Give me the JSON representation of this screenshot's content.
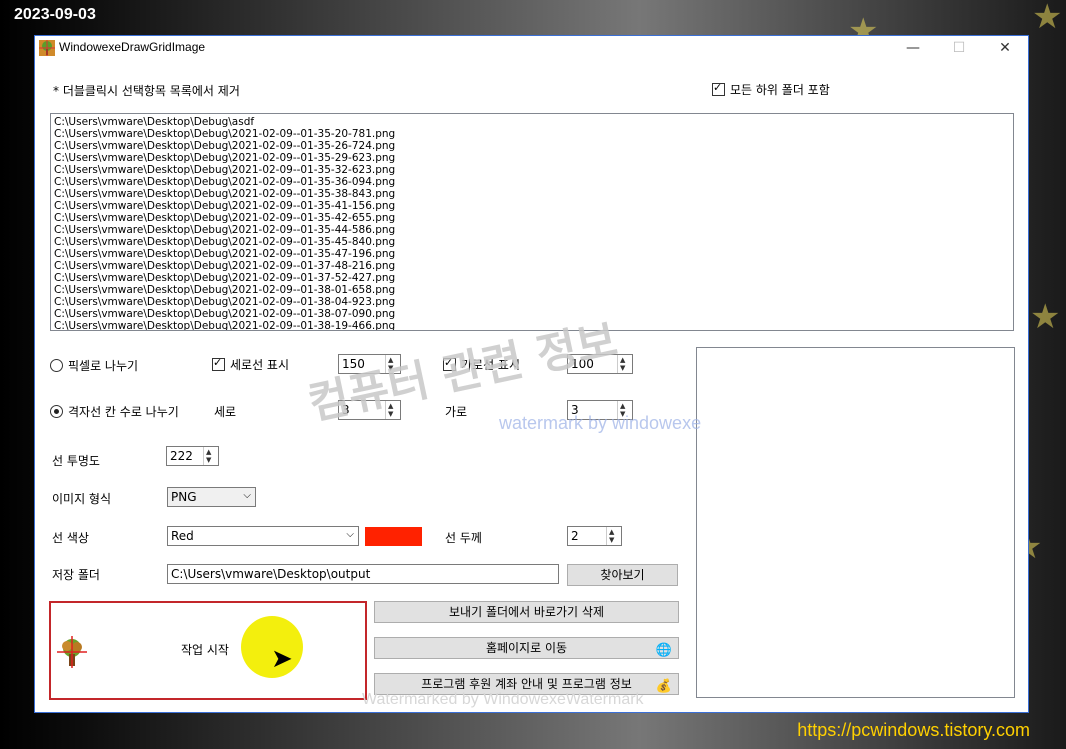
{
  "overlay": {
    "date": "2023-09-03",
    "site_url": "https://pcwindows.tistory.com"
  },
  "window": {
    "title": "WindowexeDrawGridImage",
    "minimize": "—",
    "maximize": "☐",
    "close": "✕"
  },
  "header": {
    "hint": "* 더블클릭시 선택항목 목록에서 제거",
    "include_subfolders": "모든 하위 폴더 포함"
  },
  "files": [
    "C:\\Users\\vmware\\Desktop\\Debug\\asdf",
    "C:\\Users\\vmware\\Desktop\\Debug\\2021-02-09--01-35-20-781.png",
    "C:\\Users\\vmware\\Desktop\\Debug\\2021-02-09--01-35-26-724.png",
    "C:\\Users\\vmware\\Desktop\\Debug\\2021-02-09--01-35-29-623.png",
    "C:\\Users\\vmware\\Desktop\\Debug\\2021-02-09--01-35-32-623.png",
    "C:\\Users\\vmware\\Desktop\\Debug\\2021-02-09--01-35-36-094.png",
    "C:\\Users\\vmware\\Desktop\\Debug\\2021-02-09--01-35-38-843.png",
    "C:\\Users\\vmware\\Desktop\\Debug\\2021-02-09--01-35-41-156.png",
    "C:\\Users\\vmware\\Desktop\\Debug\\2021-02-09--01-35-42-655.png",
    "C:\\Users\\vmware\\Desktop\\Debug\\2021-02-09--01-35-44-586.png",
    "C:\\Users\\vmware\\Desktop\\Debug\\2021-02-09--01-35-45-840.png",
    "C:\\Users\\vmware\\Desktop\\Debug\\2021-02-09--01-35-47-196.png",
    "C:\\Users\\vmware\\Desktop\\Debug\\2021-02-09--01-37-48-216.png",
    "C:\\Users\\vmware\\Desktop\\Debug\\2021-02-09--01-37-52-427.png",
    "C:\\Users\\vmware\\Desktop\\Debug\\2021-02-09--01-38-01-658.png",
    "C:\\Users\\vmware\\Desktop\\Debug\\2021-02-09--01-38-04-923.png",
    "C:\\Users\\vmware\\Desktop\\Debug\\2021-02-09--01-38-07-090.png",
    "C:\\Users\\vmware\\Desktop\\Debug\\2021-02-09--01-38-19-466.png"
  ],
  "grid": {
    "pixel_mode_label": "픽셀로 나누기",
    "vertical_line_label": "세로선 표시",
    "vertical_line_value": "150",
    "horizontal_line_label": "가로선 표시",
    "horizontal_line_value": "100",
    "cell_mode_label": "격자선 칸 수로 나누기",
    "rows_label": "세로",
    "rows_value": "3",
    "cols_label": "가로",
    "cols_value": "3",
    "opacity_label": "선 투명도",
    "opacity_value": "222",
    "format_label": "이미지 형식",
    "format_value": "PNG",
    "color_label": "선 색상",
    "color_value": "Red",
    "color_hex": "#ff2200",
    "thickness_label": "선 두께",
    "thickness_value": "2",
    "folder_label": "저장 폴더",
    "folder_value": "C:\\Users\\vmware\\Desktop\\output",
    "browse_button": "찾아보기"
  },
  "actions": {
    "start_button": "작업 시작",
    "delete_shortcut_button": "보내기 폴더에서 바로가기 삭제",
    "homepage_button": "홈페이지로 이동",
    "donate_button": "프로그램 후원 계좌 안내 및 프로그램 정보"
  },
  "icons": {
    "globe": "globe-icon",
    "coins": "coins-icon",
    "tree": "tree-icon",
    "cursor": "mouse-cursor-icon"
  },
  "watermarks": {
    "korean": "컴퓨터 관련 정보",
    "english": "watermark by windowexe",
    "bottom": "Watermarked by WindowexeWatermark"
  }
}
